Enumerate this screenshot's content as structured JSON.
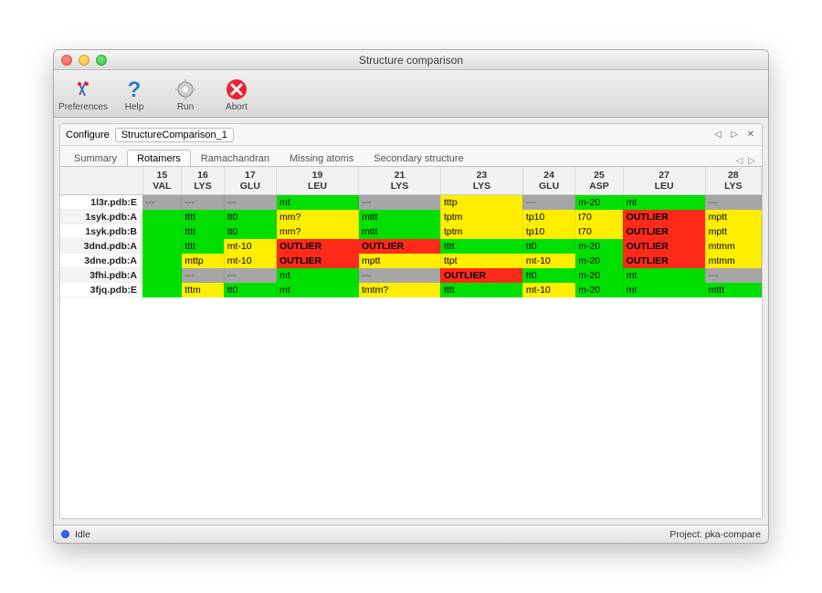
{
  "window": {
    "title": "Structure comparison"
  },
  "toolbar": {
    "items": [
      {
        "label": "Preferences",
        "icon": "prefs"
      },
      {
        "label": "Help",
        "icon": "help"
      },
      {
        "label": "Run",
        "icon": "run"
      },
      {
        "label": "Abort",
        "icon": "abort"
      }
    ]
  },
  "configure": {
    "label": "Configure",
    "value": "StructureComparison_1"
  },
  "tabs": {
    "items": [
      {
        "label": "Summary",
        "active": false
      },
      {
        "label": "Rotamers",
        "active": true
      },
      {
        "label": "Ramachandran",
        "active": false
      },
      {
        "label": "Missing atoms",
        "active": false
      },
      {
        "label": "Secondary structure",
        "active": false
      }
    ]
  },
  "table": {
    "columns": [
      {
        "num": "15",
        "res": "VAL"
      },
      {
        "num": "16",
        "res": "LYS"
      },
      {
        "num": "17",
        "res": "GLU"
      },
      {
        "num": "19",
        "res": "LEU"
      },
      {
        "num": "21",
        "res": "LYS"
      },
      {
        "num": "23",
        "res": "LYS"
      },
      {
        "num": "24",
        "res": "GLU"
      },
      {
        "num": "25",
        "res": "ASP"
      },
      {
        "num": "27",
        "res": "LEU"
      },
      {
        "num": "28",
        "res": "LYS"
      }
    ],
    "rows": [
      {
        "label": "1l3r.pdb:E",
        "cells": [
          {
            "v": "---",
            "c": "none"
          },
          {
            "v": "---",
            "c": "none"
          },
          {
            "v": "---",
            "c": "none"
          },
          {
            "v": "mt",
            "c": "green"
          },
          {
            "v": "---",
            "c": "none"
          },
          {
            "v": "tttp",
            "c": "yellow"
          },
          {
            "v": "---",
            "c": "none"
          },
          {
            "v": "m-20",
            "c": "green"
          },
          {
            "v": "mt",
            "c": "green"
          },
          {
            "v": "---",
            "c": "none"
          }
        ]
      },
      {
        "label": "1syk.pdb:A",
        "cells": [
          {
            "v": "",
            "c": "green"
          },
          {
            "v": "tttt",
            "c": "green"
          },
          {
            "v": "tt0",
            "c": "green"
          },
          {
            "v": "mm?",
            "c": "yellow"
          },
          {
            "v": "mttt",
            "c": "green"
          },
          {
            "v": "tptm",
            "c": "yellow"
          },
          {
            "v": "tp10",
            "c": "yellow"
          },
          {
            "v": "t70",
            "c": "yellow"
          },
          {
            "v": "OUTLIER",
            "c": "red"
          },
          {
            "v": "mptt",
            "c": "yellow"
          }
        ]
      },
      {
        "label": "1syk.pdb:B",
        "cells": [
          {
            "v": "",
            "c": "green"
          },
          {
            "v": "tttt",
            "c": "green"
          },
          {
            "v": "tt0",
            "c": "green"
          },
          {
            "v": "mm?",
            "c": "yellow"
          },
          {
            "v": "mttt",
            "c": "green"
          },
          {
            "v": "tptm",
            "c": "yellow"
          },
          {
            "v": "tp10",
            "c": "yellow"
          },
          {
            "v": "t70",
            "c": "yellow"
          },
          {
            "v": "OUTLIER",
            "c": "red"
          },
          {
            "v": "mptt",
            "c": "yellow"
          }
        ]
      },
      {
        "label": "3dnd.pdb:A",
        "cells": [
          {
            "v": "",
            "c": "green"
          },
          {
            "v": "tttt",
            "c": "green"
          },
          {
            "v": "mt-10",
            "c": "yellow"
          },
          {
            "v": "OUTLIER",
            "c": "red"
          },
          {
            "v": "OUTLIER",
            "c": "red"
          },
          {
            "v": "tttt",
            "c": "green"
          },
          {
            "v": "tt0",
            "c": "green"
          },
          {
            "v": "m-20",
            "c": "green"
          },
          {
            "v": "OUTLIER",
            "c": "red"
          },
          {
            "v": "mtmm",
            "c": "yellow"
          }
        ]
      },
      {
        "label": "3dne.pdb:A",
        "cells": [
          {
            "v": "",
            "c": "green"
          },
          {
            "v": "mttp",
            "c": "yellow"
          },
          {
            "v": "mt-10",
            "c": "yellow"
          },
          {
            "v": "OUTLIER",
            "c": "red"
          },
          {
            "v": "mptt",
            "c": "yellow"
          },
          {
            "v": "ttpt",
            "c": "yellow"
          },
          {
            "v": "mt-10",
            "c": "yellow"
          },
          {
            "v": "m-20",
            "c": "green"
          },
          {
            "v": "OUTLIER",
            "c": "red"
          },
          {
            "v": "mtmm",
            "c": "yellow"
          }
        ]
      },
      {
        "label": "3fhi.pdb:A",
        "cells": [
          {
            "v": "",
            "c": "green"
          },
          {
            "v": "---",
            "c": "none"
          },
          {
            "v": "---",
            "c": "none"
          },
          {
            "v": "mt",
            "c": "green"
          },
          {
            "v": "---",
            "c": "none"
          },
          {
            "v": "OUTLIER",
            "c": "red"
          },
          {
            "v": "tt0",
            "c": "green"
          },
          {
            "v": "m-20",
            "c": "green"
          },
          {
            "v": "mt",
            "c": "green"
          },
          {
            "v": "---",
            "c": "none"
          }
        ]
      },
      {
        "label": "3fjq.pdb:E",
        "cells": [
          {
            "v": "",
            "c": "green"
          },
          {
            "v": "tttm",
            "c": "yellow"
          },
          {
            "v": "tt0",
            "c": "green"
          },
          {
            "v": "mt",
            "c": "green"
          },
          {
            "v": "tmtm?",
            "c": "yellow"
          },
          {
            "v": "tttt",
            "c": "green"
          },
          {
            "v": "mt-10",
            "c": "yellow"
          },
          {
            "v": "m-20",
            "c": "green"
          },
          {
            "v": "mt",
            "c": "green"
          },
          {
            "v": "mttt",
            "c": "green"
          }
        ]
      }
    ]
  },
  "status": {
    "state": "Idle",
    "project_label": "Project:",
    "project": "pka-compare"
  }
}
